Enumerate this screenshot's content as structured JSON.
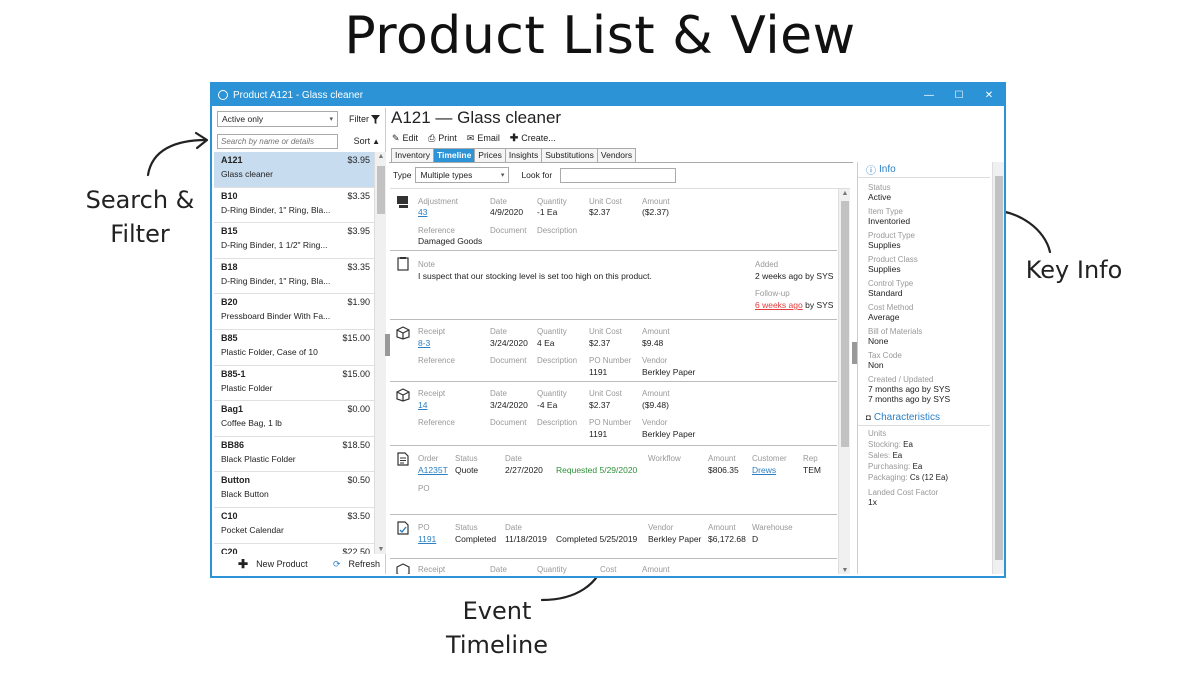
{
  "heading": "Product List & View",
  "annotations": {
    "search_filter": [
      "Search &",
      "Filter"
    ],
    "key_info": "Key Info",
    "event_timeline": [
      "Event",
      "Timeline"
    ]
  },
  "window": {
    "title": "Product A121 - Glass cleaner",
    "controls": [
      "—",
      "☐",
      "✕"
    ]
  },
  "left": {
    "filter_select": "Active only",
    "filter_btn": "Filter",
    "search_placeholder": "Search by name or details",
    "sort_btn": "Sort",
    "products": [
      {
        "code": "A121",
        "price": "$3.95",
        "desc": "Glass cleaner",
        "selected": true
      },
      {
        "code": "B10",
        "price": "$3.35",
        "desc": "D-Ring Binder, 1\" Ring, Bla..."
      },
      {
        "code": "B15",
        "price": "$3.95",
        "desc": "D-Ring Binder, 1 1/2\" Ring..."
      },
      {
        "code": "B18",
        "price": "$3.35",
        "desc": "D-Ring Binder, 1\" Ring, Bla..."
      },
      {
        "code": "B20",
        "price": "$1.90",
        "desc": "Pressboard Binder With Fa..."
      },
      {
        "code": "B85",
        "price": "$15.00",
        "desc": "Plastic Folder, Case of 10"
      },
      {
        "code": "B85-1",
        "price": "$15.00",
        "desc": "Plastic Folder"
      },
      {
        "code": "Bag1",
        "price": "$0.00",
        "desc": "Coffee Bag, 1 lb"
      },
      {
        "code": "BB86",
        "price": "$18.50",
        "desc": "Black Plastic Folder"
      },
      {
        "code": "Button",
        "price": "$0.50",
        "desc": "Black Button"
      },
      {
        "code": "C10",
        "price": "$3.50",
        "desc": "Pocket Calendar"
      },
      {
        "code": "C20",
        "price": "$22.50",
        "desc": ""
      }
    ],
    "new_product": "New Product",
    "refresh": "Refresh"
  },
  "main": {
    "product_title": "A121 — Glass cleaner",
    "toolbar": {
      "edit": "Edit",
      "print": "Print",
      "email": "Email",
      "create": "Create..."
    },
    "tabs": [
      "Inventory",
      "Timeline",
      "Prices",
      "Insights",
      "Substitutions",
      "Vendors"
    ],
    "active_tab": "Timeline",
    "type_label": "Type",
    "type_value": "Multiple types",
    "look_for_label": "Look for",
    "events": {
      "adjustment": {
        "type_label": "Adjustment",
        "id": "43",
        "date_label": "Date",
        "date": "4/9/2020",
        "qty_label": "Quantity",
        "qty": "-1 Ea",
        "cost_label": "Unit Cost",
        "cost": "$2.37",
        "amount_label": "Amount",
        "amount": "($2.37)",
        "ref_label": "Reference",
        "ref": "Damaged Goods",
        "doc_label": "Document",
        "desc_label": "Description"
      },
      "note": {
        "type_label": "Note",
        "text": "I suspect that our stocking level is set too high on this product.",
        "added_label": "Added",
        "added": "2 weeks ago by SYS",
        "follow_label": "Follow-up",
        "follow_ago": "6 weeks ago",
        "follow_by": "by SYS"
      },
      "receipt1": {
        "type_label": "Receipt",
        "id": "8-3",
        "date_label": "Date",
        "date": "3/24/2020",
        "qty_label": "Quantity",
        "qty": "4 Ea",
        "cost_label": "Unit Cost",
        "cost": "$2.37",
        "amount_label": "Amount",
        "amount": "$9.48",
        "ref_label": "Reference",
        "doc_label": "Document",
        "desc_label": "Description",
        "po_label": "PO Number",
        "po": "1191",
        "vendor_label": "Vendor",
        "vendor": "Berkley Paper"
      },
      "receipt2": {
        "type_label": "Receipt",
        "id": "14",
        "date_label": "Date",
        "date": "3/24/2020",
        "qty_label": "Quantity",
        "qty": "-4 Ea",
        "cost_label": "Unit Cost",
        "cost": "$2.37",
        "amount_label": "Amount",
        "amount": "($9.48)",
        "ref_label": "Reference",
        "doc_label": "Document",
        "desc_label": "Description",
        "po_label": "PO Number",
        "po": "1191",
        "vendor_label": "Vendor",
        "vendor": "Berkley Paper"
      },
      "order": {
        "type_label": "Order",
        "id": "A1235T",
        "status_label": "Status",
        "status": "Quote",
        "date_label": "Date",
        "date": "2/27/2020",
        "requested": "Requested 5/29/2020",
        "workflow_label": "Workflow",
        "amount_label": "Amount",
        "amount": "$806.35",
        "customer_label": "Customer",
        "customer": "Drews",
        "rep_label": "Rep",
        "rep": "TEM",
        "po_label": "PO"
      },
      "po": {
        "type_label": "PO",
        "id": "1191",
        "status_label": "Status",
        "status": "Completed",
        "date_label": "Date",
        "date": "11/18/2019",
        "completed": "Completed 5/25/2019",
        "vendor_label": "Vendor",
        "vendor": "Berkley Paper",
        "amount_label": "Amount",
        "amount": "$6,172.68",
        "warehouse_label": "Warehouse",
        "warehouse": "D"
      },
      "receipt3": {
        "type_label": "Receipt",
        "date_label": "Date",
        "qty_label": "Quantity",
        "cost_label": "Cost",
        "amount_label": "Amount"
      }
    }
  },
  "info": {
    "header": "Info",
    "fields": [
      {
        "label": "Status",
        "value": "Active"
      },
      {
        "label": "Item Type",
        "value": "Inventoried"
      },
      {
        "label": "Product Type",
        "value": "Supplies"
      },
      {
        "label": "Product Class",
        "value": "Supplies"
      },
      {
        "label": "Control Type",
        "value": "Standard"
      },
      {
        "label": "Cost Method",
        "value": "Average"
      },
      {
        "label": "Bill of Materials",
        "value": "None"
      },
      {
        "label": "Tax Code",
        "value": "Non"
      }
    ],
    "created_label": "Created / Updated",
    "created": "7 months ago by SYS",
    "updated": "7 months ago by SYS",
    "characteristics_header": "Characteristics",
    "units_label": "Units",
    "units": [
      {
        "label": "Stocking:",
        "value": "Ea"
      },
      {
        "label": "Sales:",
        "value": "Ea"
      },
      {
        "label": "Purchasing:",
        "value": "Ea"
      },
      {
        "label": "Packaging:",
        "value": "Cs (12 Ea)"
      }
    ],
    "landed_label": "Landed Cost Factor",
    "landed": "1x"
  },
  "colors": {
    "accent": "#2b93d6",
    "link": "#2b7fc3",
    "selected_row": "#c8dcef",
    "overdue": "#e23b3b",
    "ok": "#2f8f3a"
  }
}
